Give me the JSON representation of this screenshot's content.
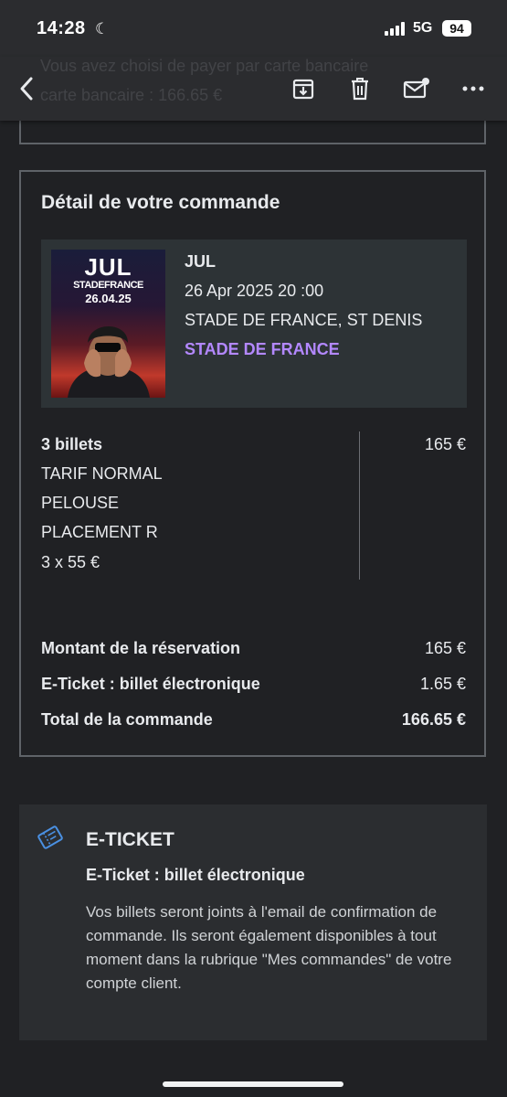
{
  "status": {
    "time": "14:28",
    "network": "5G",
    "battery": "94"
  },
  "toolbar": {
    "back_icon": "back-arrow-icon",
    "ghost_line1": "Vous avez choisi de payer par carte bancaire",
    "ghost_line2": "carte bancaire : 166.65 €",
    "icons": [
      "archive-icon",
      "trash-icon",
      "mark-unread-icon",
      "more-icon"
    ]
  },
  "order": {
    "title": "Détail de votre commande",
    "poster": {
      "logo": "JUL",
      "venue": "STADEFRANCE",
      "date": "26.04.25"
    },
    "event": {
      "artist": "JUL",
      "datetime": "26 Apr 2025 20 :00",
      "location": "STADE DE FRANCE, ST DENIS",
      "venue": "STADE DE FRANCE"
    },
    "tickets": {
      "count": "3 billets",
      "lines": [
        "TARIF NORMAL",
        "PELOUSE",
        "PLACEMENT R",
        "3 x 55 €"
      ],
      "amount": "165 €"
    },
    "summary": [
      {
        "label": "Montant de la réservation",
        "value": "165 €"
      },
      {
        "label": "E-Ticket : billet électronique",
        "value": "1.65 €"
      },
      {
        "label": "Total de la commande",
        "value": "166.65 €"
      }
    ]
  },
  "eticket": {
    "title": "E-TICKET",
    "subtitle": "E-Ticket : billet électronique",
    "body": "Vos billets seront joints à l'email de confirmation de commande. Ils seront également disponibles à tout moment dans la rubrique \"Mes commandes\" de votre compte client."
  },
  "colors": {
    "background": "#202124",
    "accent_venue": "#b388ff",
    "card_border": "#5f6368",
    "eticket_icon": "#4a90e2"
  }
}
